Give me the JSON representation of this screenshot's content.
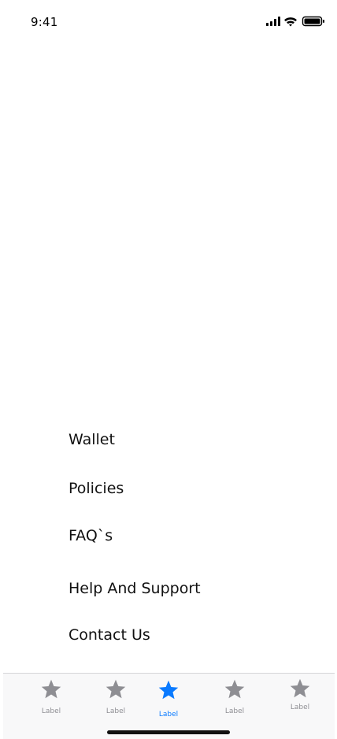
{
  "status_bar": {
    "time": "9:41",
    "icons": [
      "cellular-signal-icon",
      "wifi-icon",
      "battery-icon"
    ]
  },
  "menu": {
    "items": [
      {
        "label": "Wallet"
      },
      {
        "label": "Policies"
      },
      {
        "label": "FAQ`s"
      },
      {
        "label": "Help And Support"
      },
      {
        "label": "Contact Us"
      }
    ]
  },
  "tab_bar": {
    "tabs": [
      {
        "label": "Label",
        "icon": "star-icon",
        "active": false
      },
      {
        "label": "Label",
        "icon": "star-icon",
        "active": false
      },
      {
        "label": "Label",
        "icon": "star-icon",
        "active": true
      },
      {
        "label": "Label",
        "icon": "star-icon",
        "active": false
      },
      {
        "label": "Label",
        "icon": "star-icon",
        "active": false
      }
    ],
    "colors": {
      "active": "#0a7aff",
      "inactive": "#8e8e93"
    }
  }
}
